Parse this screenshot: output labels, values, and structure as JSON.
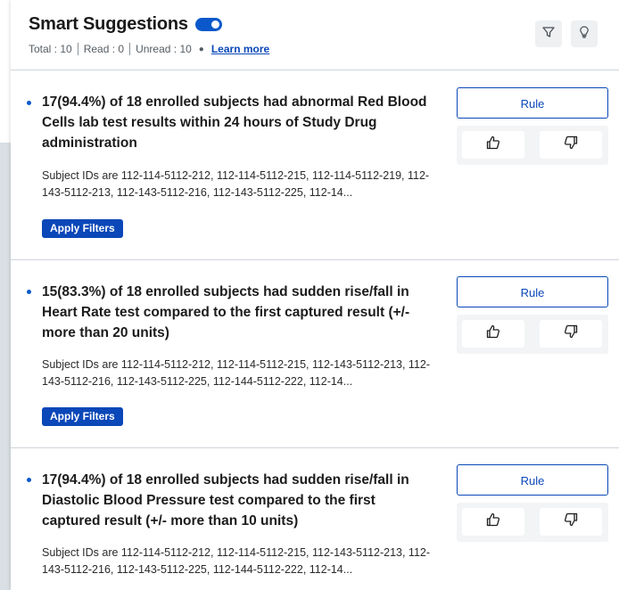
{
  "header": {
    "title": "Smart Suggestions",
    "toggle_on": true,
    "stats": {
      "total": "Total : 10",
      "read": "Read : 0",
      "unread": "Unread : 10"
    },
    "learn_more": "Learn more",
    "filter_icon": "filter-icon",
    "bulb_icon": "lightbulb-icon"
  },
  "suggestions": [
    {
      "title": "17(94.4%) of 18 enrolled subjects had abnormal Red Blood Cells lab test results within 24 hours of Study Drug administration",
      "description": "Subject IDs are 112-114-5112-212, 112-114-5112-215, 112-114-5112-219, 112-143-5112-213, 112-143-5112-216, 112-143-5112-225, 112-14...",
      "apply_label": "Apply Filters",
      "rule_label": "Rule"
    },
    {
      "title": "15(83.3%) of 18 enrolled subjects had sudden rise/fall in Heart Rate test compared to the first captured result (+/- more than 20 units)",
      "description": "Subject IDs are 112-114-5112-212, 112-114-5112-215, 112-143-5112-213, 112-143-5112-216, 112-143-5112-225, 112-144-5112-222, 112-14...",
      "apply_label": "Apply Filters",
      "rule_label": "Rule"
    },
    {
      "title": "17(94.4%) of 18 enrolled subjects had sudden rise/fall in Diastolic Blood Pressure test compared to the first captured result (+/- more than 10 units)",
      "description": "Subject IDs are 112-114-5112-212, 112-114-5112-215, 112-143-5112-213, 112-143-5112-216, 112-143-5112-225, 112-144-5112-222, 112-14...",
      "rule_label": "Rule"
    }
  ],
  "colors": {
    "accent": "#0a47b8",
    "toggle": "#0a58ca",
    "divider": "#cfd5db",
    "feedback_bg": "#f3f4f5",
    "page_bg": "#d9dfe4"
  }
}
